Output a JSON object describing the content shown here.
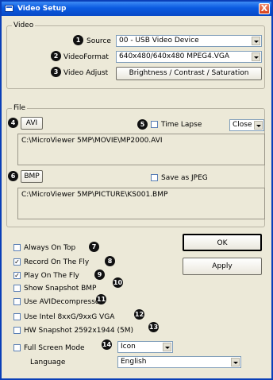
{
  "window": {
    "title": "Video Setup",
    "close_glyph": "X"
  },
  "video": {
    "legend": "Video",
    "source_label": "Source",
    "source_value": "00 - USB Video Device",
    "format_label": "VideoFormat",
    "format_value": "640x480/640x480 MPEG4.VGA",
    "adjust_label": "Video Adjust",
    "adjust_button": "Brightness / Contrast / Saturation",
    "badges": [
      "1",
      "2",
      "3"
    ]
  },
  "file": {
    "legend": "File",
    "avi_button": "AVI",
    "time_lapse_label": "Time Lapse",
    "time_lapse_checked": false,
    "close_value": "Close",
    "avi_path": "C:\\MicroViewer 5MP\\MOVIE\\MP2000.AVI",
    "bmp_button": "BMP",
    "save_jpeg_label": "Save as JPEG",
    "save_jpeg_checked": false,
    "bmp_path": "C:\\MicroViewer 5MP\\PICTURE\\KS001.BMP",
    "badges": [
      "4",
      "5",
      "6"
    ]
  },
  "buttons": {
    "ok": "OK",
    "apply": "Apply"
  },
  "options": [
    {
      "label": "Always On Top",
      "checked": false,
      "badge": "7"
    },
    {
      "label": "Record On The Fly",
      "checked": true,
      "badge": "8"
    },
    {
      "label": "Play On The Fly",
      "checked": true,
      "badge": "9"
    },
    {
      "label": "Show Snapshot BMP",
      "checked": false,
      "badge": "10"
    },
    {
      "label": "Use AVIDecompressor",
      "checked": false,
      "badge": "11"
    },
    {
      "label": "Use Intel 8xxG/9xxG VGA",
      "checked": false,
      "badge": "12"
    },
    {
      "label": "HW Snapshot 2592x1944 (5M)",
      "checked": false,
      "badge": "13"
    }
  ],
  "fullscreen": {
    "label": "Full Screen Mode",
    "checked": false,
    "badge": "14",
    "mode_value": "Icon"
  },
  "language": {
    "label": "Language",
    "value": "English"
  }
}
